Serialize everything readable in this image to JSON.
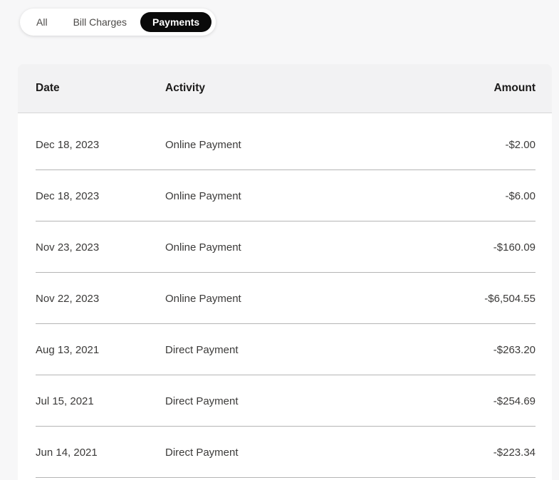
{
  "tabs": {
    "items": [
      {
        "label": "All",
        "selected": false
      },
      {
        "label": "Bill Charges",
        "selected": false
      },
      {
        "label": "Payments",
        "selected": true
      }
    ],
    "selected_bg": "#0a0a0a",
    "selected_text": "#ffffff"
  },
  "table": {
    "columns": {
      "date": "Date",
      "activity": "Activity",
      "amount": "Amount"
    },
    "rows": [
      {
        "date": "Dec 18, 2023",
        "activity": "Online Payment",
        "amount": "-$2.00"
      },
      {
        "date": "Dec 18, 2023",
        "activity": "Online Payment",
        "amount": "-$6.00"
      },
      {
        "date": "Nov 23, 2023",
        "activity": "Online Payment",
        "amount": "-$160.09"
      },
      {
        "date": "Nov 22, 2023",
        "activity": "Online Payment",
        "amount": "-$6,504.55"
      },
      {
        "date": "Aug 13, 2021",
        "activity": "Direct Payment",
        "amount": "-$263.20"
      },
      {
        "date": "Jul 15, 2021",
        "activity": "Direct Payment",
        "amount": "-$254.69"
      },
      {
        "date": "Jun 14, 2021",
        "activity": "Direct Payment",
        "amount": "-$223.34"
      }
    ]
  },
  "colors": {
    "page_bg": "#f7f7f8",
    "header_bg": "#f2f2f3",
    "row_divider": "#b5b5b5",
    "cell_text": "#3b3a39"
  }
}
